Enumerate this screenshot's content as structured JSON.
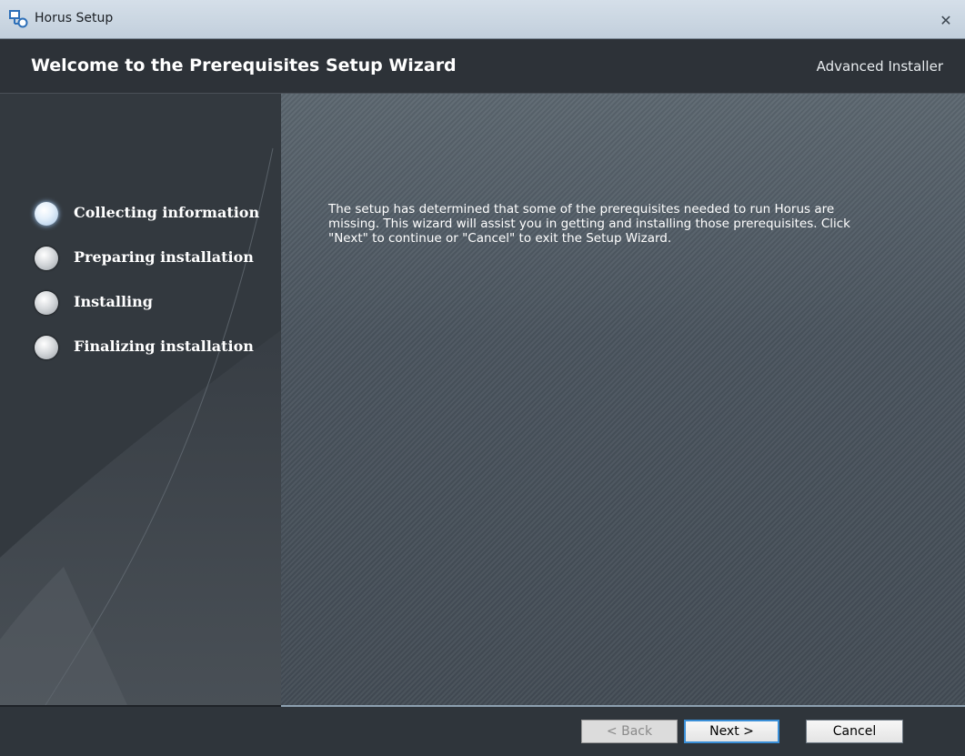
{
  "window": {
    "title": "Horus Setup",
    "close_icon": "close-icon"
  },
  "header": {
    "heading": "Welcome to the Prerequisites Setup Wizard",
    "brand": "Advanced Installer"
  },
  "sidebar": {
    "steps": [
      {
        "label": "Collecting information",
        "state": "current"
      },
      {
        "label": "Preparing installation",
        "state": "pending"
      },
      {
        "label": "Installing",
        "state": "pending"
      },
      {
        "label": "Finalizing installation",
        "state": "pending"
      }
    ]
  },
  "content": {
    "message": "The setup has determined that some of the prerequisites needed to run Horus are missing. This wizard will assist you in getting and installing those prerequisites. Click \"Next\" to continue or \"Cancel\" to exit the Setup Wizard."
  },
  "footer": {
    "back_label": "< Back",
    "next_label": "Next >",
    "cancel_label": "Cancel",
    "back_enabled": false
  },
  "colors": {
    "accent": "#3a8fd8",
    "header_bg": "#2d3238",
    "content_bg": "#4a555f"
  }
}
